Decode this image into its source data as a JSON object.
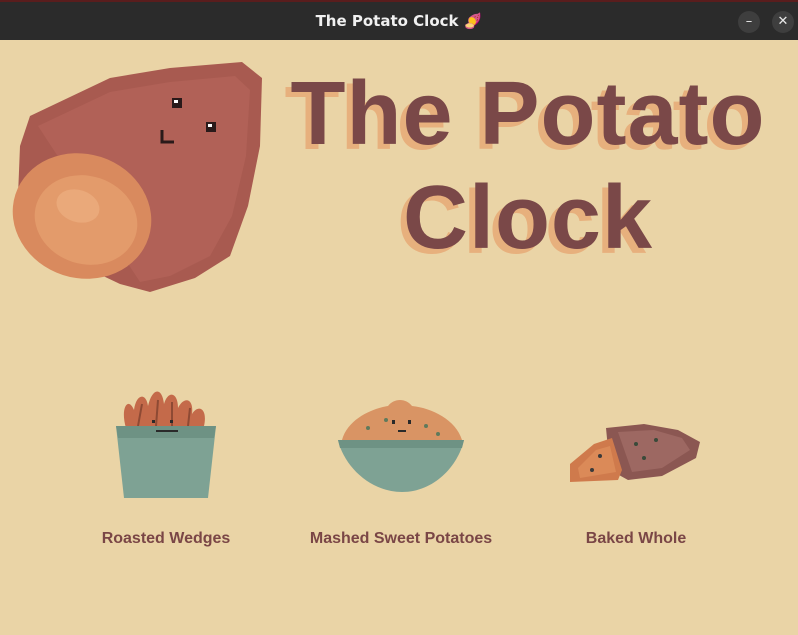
{
  "window": {
    "title": "The Potato Clock 🍠",
    "minimize_glyph": "–",
    "close_glyph": "✕"
  },
  "header": {
    "title_line1": "The Potato",
    "title_line2": "Clock"
  },
  "options": [
    {
      "label": "Roasted Wedges",
      "icon": "roasted-wedges-icon"
    },
    {
      "label": "Mashed Sweet Potatoes",
      "icon": "mashed-sweet-potatoes-icon"
    },
    {
      "label": "Baked Whole",
      "icon": "baked-whole-icon"
    }
  ],
  "colors": {
    "background": "#ead4a6",
    "title_text": "#7a4848",
    "title_shadow": "#e7b07d",
    "label_text": "#7a4646"
  }
}
